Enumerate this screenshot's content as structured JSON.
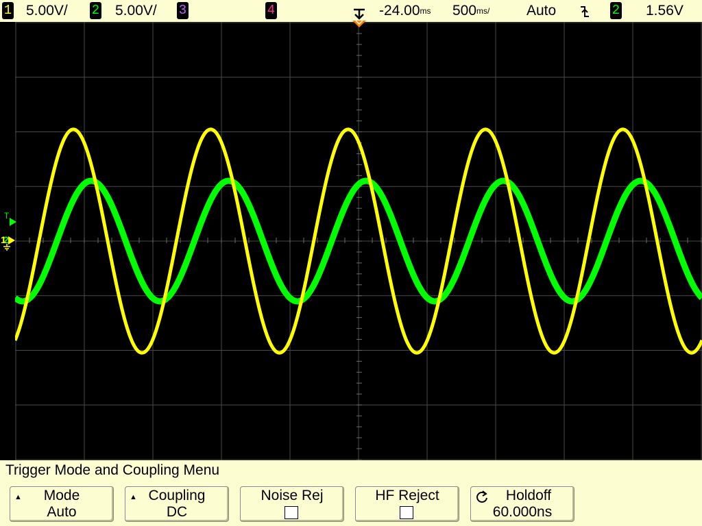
{
  "status": {
    "ch1_number": "1",
    "ch1_scale": "5.00V/",
    "ch2_number": "2",
    "ch2_scale": "5.00V/",
    "ch3_number": "3",
    "ch4_number": "4",
    "time_delay": "-24.00",
    "time_delay_unit": "ms",
    "time_scale": "500",
    "time_scale_unit": "ms/",
    "trigger_mode": "Auto",
    "trigger_source_number": "2",
    "trigger_level": "1.56V"
  },
  "colors": {
    "ch1": "#ffff00",
    "ch2": "#00ff00",
    "ch3": "#9400d3",
    "ch4": "#ff1493",
    "trigger_marker": "#ff8000",
    "graticule": "#4a4a4a",
    "menu_bg": "#fdfdd2"
  },
  "markers": {
    "trigger_level_label": "T",
    "ch1_ground": "1",
    "ch2_ground": "2"
  },
  "menu": {
    "title": "Trigger Mode and Coupling Menu",
    "softkeys": [
      {
        "label": "Mode",
        "value": "Auto",
        "icon": "up-arrow-icon"
      },
      {
        "label": "Coupling",
        "value": "DC",
        "icon": "up-arrow-icon"
      },
      {
        "label": "Noise Rej",
        "value": "",
        "checked": false
      },
      {
        "label": "HF Reject",
        "value": "",
        "checked": false
      },
      {
        "label": "Holdoff",
        "value": "60.000ns",
        "icon": "rotate-knob-icon"
      }
    ]
  },
  "chart_data": {
    "type": "line",
    "xlabel": "",
    "ylabel": "",
    "xlim": [
      -2.524,
      2.476
    ],
    "ylim": [
      -20,
      20
    ],
    "x_unit": "s",
    "y_unit": "V",
    "grid": true,
    "divisions": {
      "x": 10,
      "y": 8
    },
    "series": [
      {
        "name": "1",
        "waveform": "sine",
        "amplitude_v": 10.2,
        "period_s": 1.0,
        "phase_deg": 126,
        "offset_v": 0.0
      },
      {
        "name": "2",
        "waveform": "sine",
        "amplitude_v": 5.5,
        "period_s": 1.0,
        "phase_deg": 79,
        "offset_v": 0.0
      }
    ]
  }
}
